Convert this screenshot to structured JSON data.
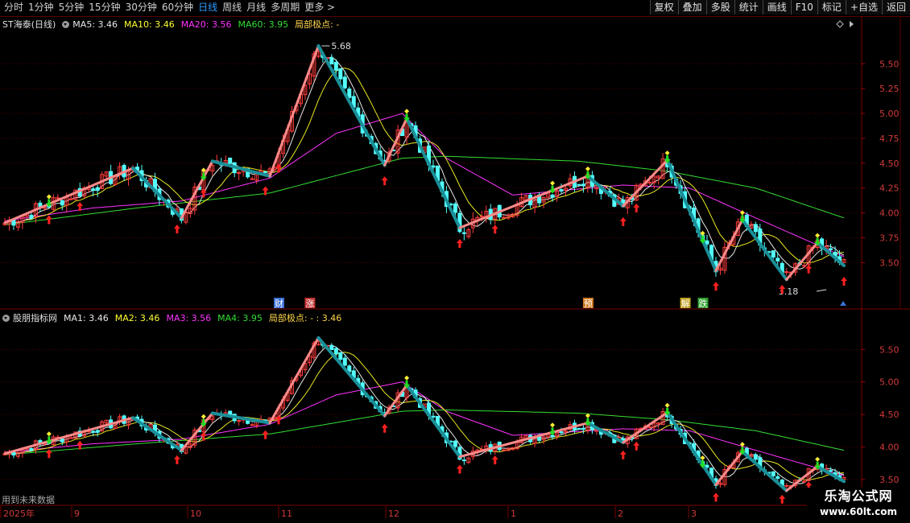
{
  "toolbar": {
    "tabs": [
      {
        "label": "分时",
        "active": false
      },
      {
        "label": "1分钟",
        "active": false
      },
      {
        "label": "5分钟",
        "active": false
      },
      {
        "label": "15分钟",
        "active": false
      },
      {
        "label": "30分钟",
        "active": false
      },
      {
        "label": "60分钟",
        "active": false
      },
      {
        "label": "日线",
        "active": true
      },
      {
        "label": "周线",
        "active": false
      },
      {
        "label": "月线",
        "active": false
      },
      {
        "label": "多周期",
        "active": false
      },
      {
        "label": "更多 >",
        "active": false
      }
    ],
    "buttons": [
      "复权",
      "叠加",
      "多股",
      "统计",
      "画线",
      "F10",
      "标记",
      "+自选",
      "返回"
    ]
  },
  "upper": {
    "title": "ST海泰(日线)",
    "ma": [
      {
        "label": "MA5: 3.46",
        "color": "#e8e8e8"
      },
      {
        "label": "MA10: 3.46",
        "color": "#ffff33"
      },
      {
        "label": "MA20: 3.56",
        "color": "#ff33ff"
      },
      {
        "label": "MA60: 3.95",
        "color": "#33dd33"
      }
    ],
    "extreme_label": "局部极点: -",
    "high_label": "5.68",
    "low_label": "3.18",
    "event_tags": [
      {
        "text": "财",
        "color": "#3b6fd6"
      },
      {
        "text": "涨",
        "color": "#c23030"
      },
      {
        "text": "预",
        "color": "#d07a20"
      },
      {
        "text": "解",
        "color": "#c0a020"
      },
      {
        "text": "跌",
        "color": "#2e9e2e"
      }
    ]
  },
  "lower": {
    "title": "股朋指标网",
    "ma": [
      {
        "label": "MA1: 3.46",
        "color": "#e8e8e8"
      },
      {
        "label": "MA2: 3.46",
        "color": "#ffff33"
      },
      {
        "label": "MA3: 3.56",
        "color": "#ff33ff"
      },
      {
        "label": "MA4: 3.95",
        "color": "#33dd33"
      }
    ],
    "extreme_label": "局部极点: - : 3.46"
  },
  "axis": {
    "upper_ticks": [
      "5.50",
      "5.25",
      "5.00",
      "4.75",
      "4.50",
      "4.25",
      "4.00",
      "3.75",
      "3.50"
    ],
    "lower_ticks": [
      "5.50",
      "5.00",
      "4.50",
      "4.00",
      "3.50"
    ],
    "month_labels": [
      "2025年",
      "9",
      "10",
      "11",
      "12",
      "1",
      "2",
      "3"
    ]
  },
  "bottom_note": "用到未来数据",
  "watermark": {
    "line1": "乐淘公式网",
    "line2": "www.60lt.com"
  },
  "chart_data": {
    "type": "candlestick",
    "ylim_upper": [
      3.05,
      5.85
    ],
    "ylim_lower": [
      3.45,
      5.9
    ],
    "zigzag": [
      {
        "day": 0,
        "price": 3.9,
        "dir": "up"
      },
      {
        "day": 29,
        "price": 4.45,
        "dir": "down"
      },
      {
        "day": 40,
        "price": 3.95,
        "dir": "up"
      },
      {
        "day": 47,
        "price": 4.52,
        "dir": "down"
      },
      {
        "day": 60,
        "price": 4.37,
        "dir": "up"
      },
      {
        "day": 71,
        "price": 5.68,
        "dir": "down"
      },
      {
        "day": 86,
        "price": 4.48,
        "dir": "up"
      },
      {
        "day": 91,
        "price": 4.95,
        "dir": "down"
      },
      {
        "day": 103,
        "price": 3.85,
        "dir": "up"
      },
      {
        "day": 132,
        "price": 4.37,
        "dir": "down"
      },
      {
        "day": 140,
        "price": 4.07,
        "dir": "up"
      },
      {
        "day": 150,
        "price": 4.53,
        "dir": "down"
      },
      {
        "day": 161,
        "price": 3.42,
        "dir": "up"
      },
      {
        "day": 167,
        "price": 3.93,
        "dir": "down"
      },
      {
        "day": 177,
        "price": 3.33,
        "dir": "up"
      },
      {
        "day": 184,
        "price": 3.7,
        "dir": "down"
      },
      {
        "day": 190,
        "price": 3.47,
        "dir": "down"
      }
    ],
    "ma60_path": [
      {
        "day": 0,
        "price": 3.88
      },
      {
        "day": 30,
        "price": 4.05
      },
      {
        "day": 60,
        "price": 4.2
      },
      {
        "day": 90,
        "price": 4.55
      },
      {
        "day": 100,
        "price": 4.57
      },
      {
        "day": 130,
        "price": 4.52
      },
      {
        "day": 150,
        "price": 4.42
      },
      {
        "day": 170,
        "price": 4.25
      },
      {
        "day": 190,
        "price": 3.95
      }
    ],
    "ma20_path": [
      {
        "day": 0,
        "price": 3.92
      },
      {
        "day": 20,
        "price": 4.05
      },
      {
        "day": 40,
        "price": 4.12
      },
      {
        "day": 60,
        "price": 4.35
      },
      {
        "day": 75,
        "price": 4.8
      },
      {
        "day": 90,
        "price": 5.0
      },
      {
        "day": 100,
        "price": 4.55
      },
      {
        "day": 115,
        "price": 4.18
      },
      {
        "day": 140,
        "price": 4.28
      },
      {
        "day": 155,
        "price": 4.25
      },
      {
        "day": 170,
        "price": 3.95
      },
      {
        "day": 190,
        "price": 3.56
      }
    ],
    "buy_days": [
      10,
      17,
      39,
      45,
      59,
      62,
      86,
      103,
      111,
      140,
      143,
      161,
      176,
      182,
      190
    ],
    "sell_days": [
      10,
      45,
      91,
      124,
      132,
      150,
      158,
      167,
      184
    ],
    "event_days": [
      62,
      69,
      132,
      154
    ]
  }
}
